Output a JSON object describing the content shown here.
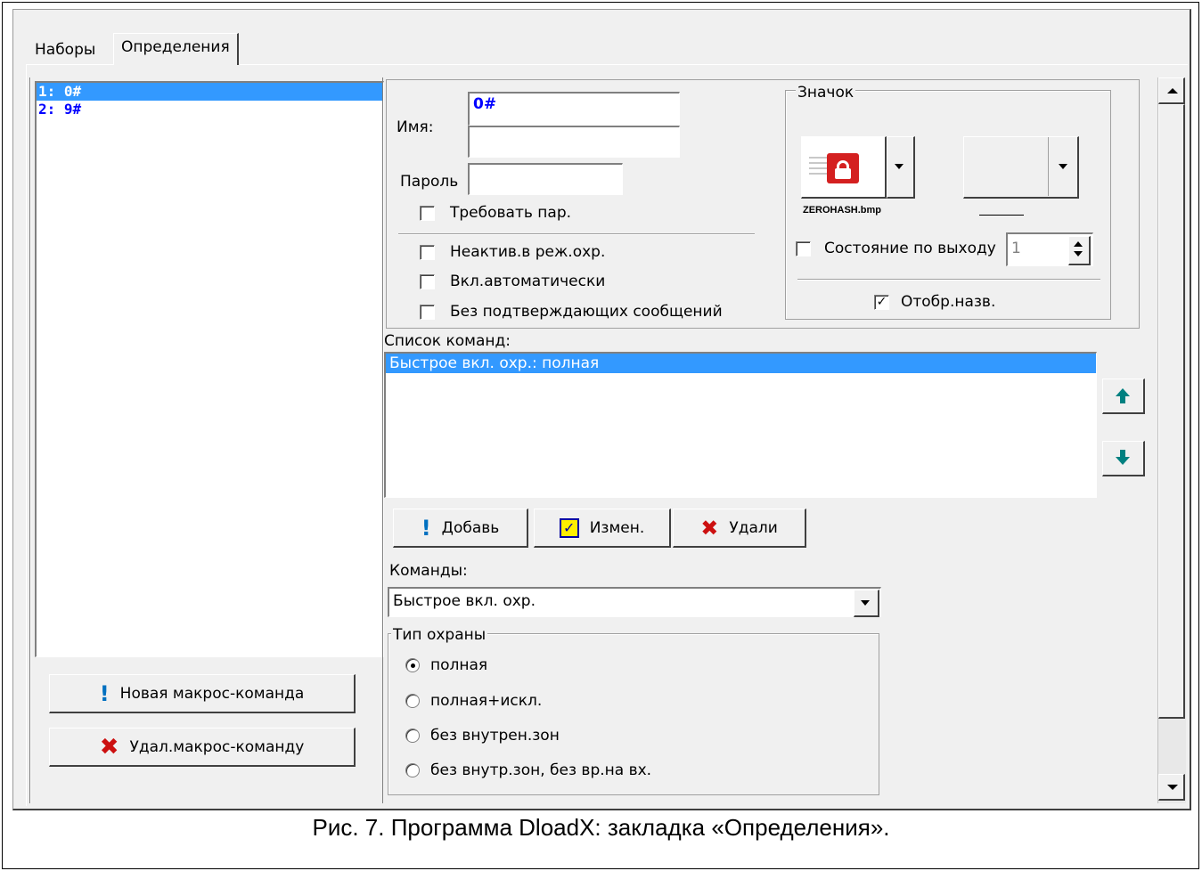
{
  "tabs": [
    "Наборы",
    "Определения"
  ],
  "macros": [
    {
      "label": "1: 0#",
      "selected": true
    },
    {
      "label": "2: 9#",
      "selected": false
    }
  ],
  "buttons": {
    "new_macro": "Новая макрос-команда",
    "delete_macro": "Удал.макрос-команду",
    "add": "Добавь",
    "edit": "Измен.",
    "delete": "Удали"
  },
  "form": {
    "name_label": "Имя:",
    "name_value": "0#",
    "name_value2": "",
    "password_label": "Пароль",
    "password_value": "",
    "require_password": "Требовать пар.",
    "inactive_armed": "Неактив.в реж.охр.",
    "auto_on": "Вкл.автоматически",
    "no_confirm": "Без подтверждающих сообщений"
  },
  "icon_group": {
    "title": "Значок",
    "icon_filename": "ZEROHASH.bmp",
    "output_state_label": "Состояние по выходу",
    "output_state_value": "1",
    "show_name_label": "Отобр.назв.",
    "show_name_checked": true,
    "check_mark": "✓"
  },
  "commands": {
    "list_label": "Список команд:",
    "items": [
      "Быстрое вкл. охр.: полная"
    ],
    "combo_label": "Команды:",
    "combo_value": "Быстрое вкл. охр."
  },
  "arm_type": {
    "title": "Тип охраны",
    "options": [
      "полная",
      "полная+искл.",
      "без внутрен.зон",
      "без внутр.зон, без вр.на вх."
    ],
    "selected_index": 0
  },
  "caption": "Рис. 7. Программа DloadX: закладка «Определения».",
  "colors": {
    "accent_blue": "#0000ff",
    "selection": "#3399ff",
    "delete_red": "#cc1010",
    "arrow_teal": "#008080"
  }
}
